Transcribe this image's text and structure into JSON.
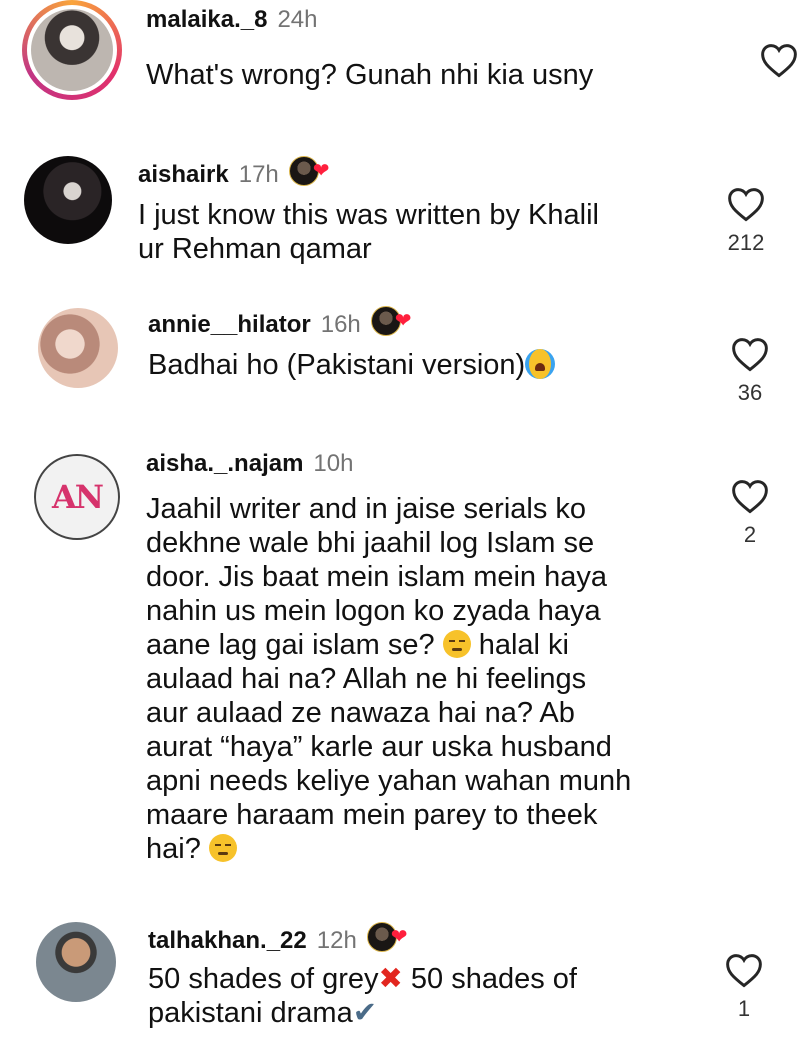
{
  "comments": [
    {
      "username": "malaika._8",
      "time": "24h",
      "author_liked": false,
      "text": [
        "What's wrong? Gunah nhi kia usny"
      ],
      "likes": ""
    },
    {
      "username": "aishairk",
      "time": "17h",
      "author_liked": true,
      "text": [
        "I just know this was written by Khalil",
        "ur Rehman qamar"
      ],
      "likes": "212"
    },
    {
      "username": "annie__hilator",
      "time": "16h",
      "author_liked": true,
      "text": [
        "Badhai ho (Pakistani version)"
      ],
      "likes": "36"
    },
    {
      "username": "aisha._.najam",
      "time": "10h",
      "author_liked": false,
      "text": [
        "Jaahil writer and in jaise serials ko",
        "dekhne wale bhi jaahil log Islam se",
        "door. Jis baat mein islam mein haya",
        "nahin us mein logon ko zyada haya",
        "aane lag gai islam se?",
        "halal ki",
        "aulaad hai na? Allah ne hi feelings",
        "aur aulaad ze nawaza hai na? Ab",
        "aurat “haya” karle aur uska husband",
        "apni needs keliye yahan wahan munh",
        "maare haraam mein parey to theek",
        "hai?"
      ],
      "likes": "2"
    },
    {
      "username": "talhakhan._22",
      "time": "12h",
      "author_liked": true,
      "text": [
        "50 shades of grey",
        "50 shades of",
        "pakistani drama"
      ],
      "likes": "1"
    }
  ],
  "avatar_logo_text": "AN",
  "colors": {
    "heart": "#ff1f3d",
    "timestamp": "#737373",
    "avatar_ring": "#f9a43b"
  },
  "icons": {
    "like": "heart-outline-icon",
    "author_liked": "heart-filled-icon",
    "emoji_1": "crying-face-emoji",
    "emoji_2": "unamused-face-emoji",
    "cross": "cross-mark-emoji",
    "check": "check-mark-emoji"
  }
}
